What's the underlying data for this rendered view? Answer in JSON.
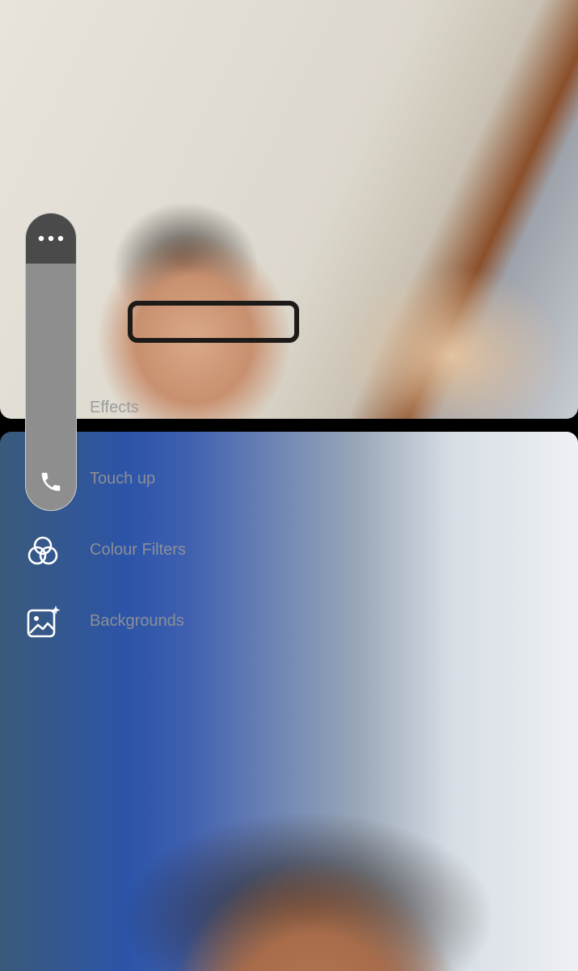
{
  "remote_video": {
    "description_name": "remote-participant-video"
  },
  "local_video": {
    "description_name": "self-view-video"
  },
  "controls": {
    "more_icon": "ellipsis-icon",
    "call_icon": "phone-icon"
  },
  "effects_menu": {
    "items": [
      {
        "label": "Effects",
        "icon": ""
      },
      {
        "label": "Touch up",
        "icon": ""
      },
      {
        "label": "Colour Filters",
        "icon": "colour-filters-icon"
      },
      {
        "label": "Backgrounds",
        "icon": "backgrounds-icon"
      }
    ]
  }
}
